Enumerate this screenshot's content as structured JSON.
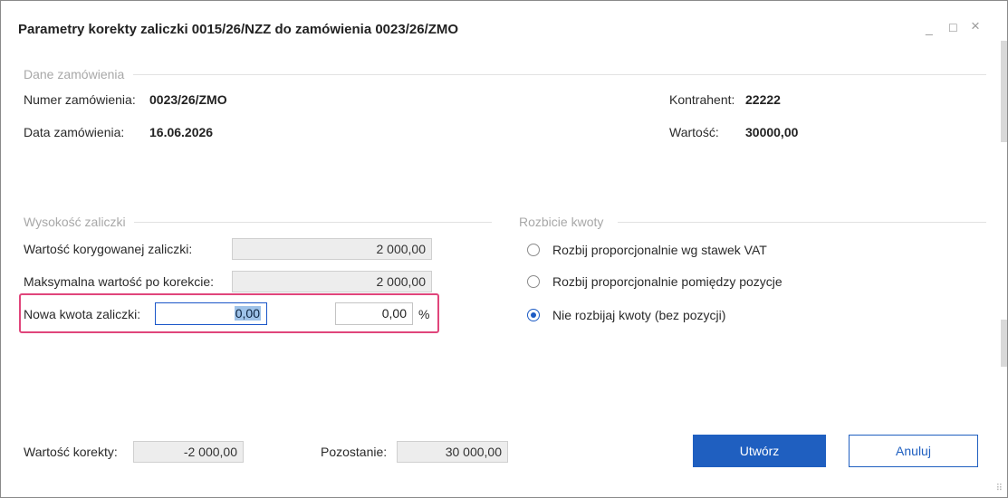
{
  "window": {
    "title": "Parametry korekty zaliczki 0015/26/NZZ do zamówienia 0023/26/ZMO",
    "controls": {
      "minimize": "_",
      "maximize": "☐",
      "close": "×"
    }
  },
  "order_section": {
    "title": "Dane zamówienia",
    "number_label": "Numer zamówienia:",
    "number_value": "0023/26/ZMO",
    "date_label": "Data zamówienia:",
    "date_value": "16.06.2026",
    "contractor_label": "Kontrahent:",
    "contractor_value": "22222",
    "value_label": "Wartość:",
    "value_value": "30000,00"
  },
  "advance_section": {
    "title": "Wysokość zaliczki",
    "corrected_label": "Wartość korygowanej zaliczki:",
    "corrected_value": "2 000,00",
    "max_label": "Maksymalna wartość po korekcie:",
    "max_value": "2 000,00",
    "new_label": "Nowa kwota zaliczki:",
    "new_value": "0,00",
    "percent_value": "0,00",
    "percent_unit": "%"
  },
  "split_section": {
    "title": "Rozbicie kwoty",
    "options": [
      {
        "label": "Rozbij proporcjonalnie wg stawek VAT",
        "selected": false
      },
      {
        "label": "Rozbij proporcjonalnie pomiędzy pozycje",
        "selected": false
      },
      {
        "label": "Nie rozbijaj kwoty (bez pozycji)",
        "selected": true
      }
    ]
  },
  "footer": {
    "correction_label": "Wartość korekty:",
    "correction_value": "-2 000,00",
    "remaining_label": "Pozostanie:",
    "remaining_value": "30 000,00",
    "create_label": "Utwórz",
    "cancel_label": "Anuluj"
  },
  "colors": {
    "accent": "#1f5fc0",
    "highlight_border": "#e0457b",
    "readonly_bg": "#ededed"
  }
}
